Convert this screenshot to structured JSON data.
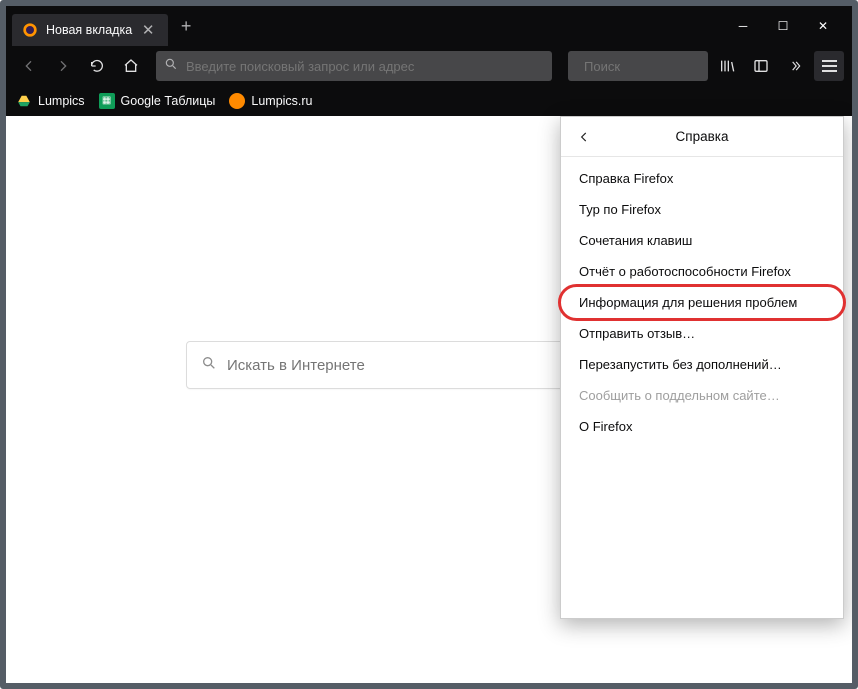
{
  "tab": {
    "title": "Новая вкладка"
  },
  "urlbar": {
    "placeholder": "Введите поисковый запрос или адрес"
  },
  "searchbar": {
    "placeholder": "Поиск"
  },
  "bookmarks": {
    "items": [
      {
        "label": "Lumpics"
      },
      {
        "label": "Google Таблицы"
      },
      {
        "label": "Lumpics.ru"
      }
    ]
  },
  "content": {
    "search_placeholder": "Искать в Интернете"
  },
  "menu": {
    "title": "Справка",
    "items": [
      {
        "label": "Справка Firefox"
      },
      {
        "label": "Тур по Firefox"
      },
      {
        "label": "Сочетания клавиш"
      },
      {
        "label": "Отчёт о работоспособности Firefox"
      },
      {
        "label": "Информация для решения проблем"
      },
      {
        "label": "Отправить отзыв…"
      },
      {
        "label": "Перезапустить без дополнений…"
      },
      {
        "label": "Сообщить о поддельном сайте…"
      },
      {
        "label": "О Firefox"
      }
    ]
  }
}
